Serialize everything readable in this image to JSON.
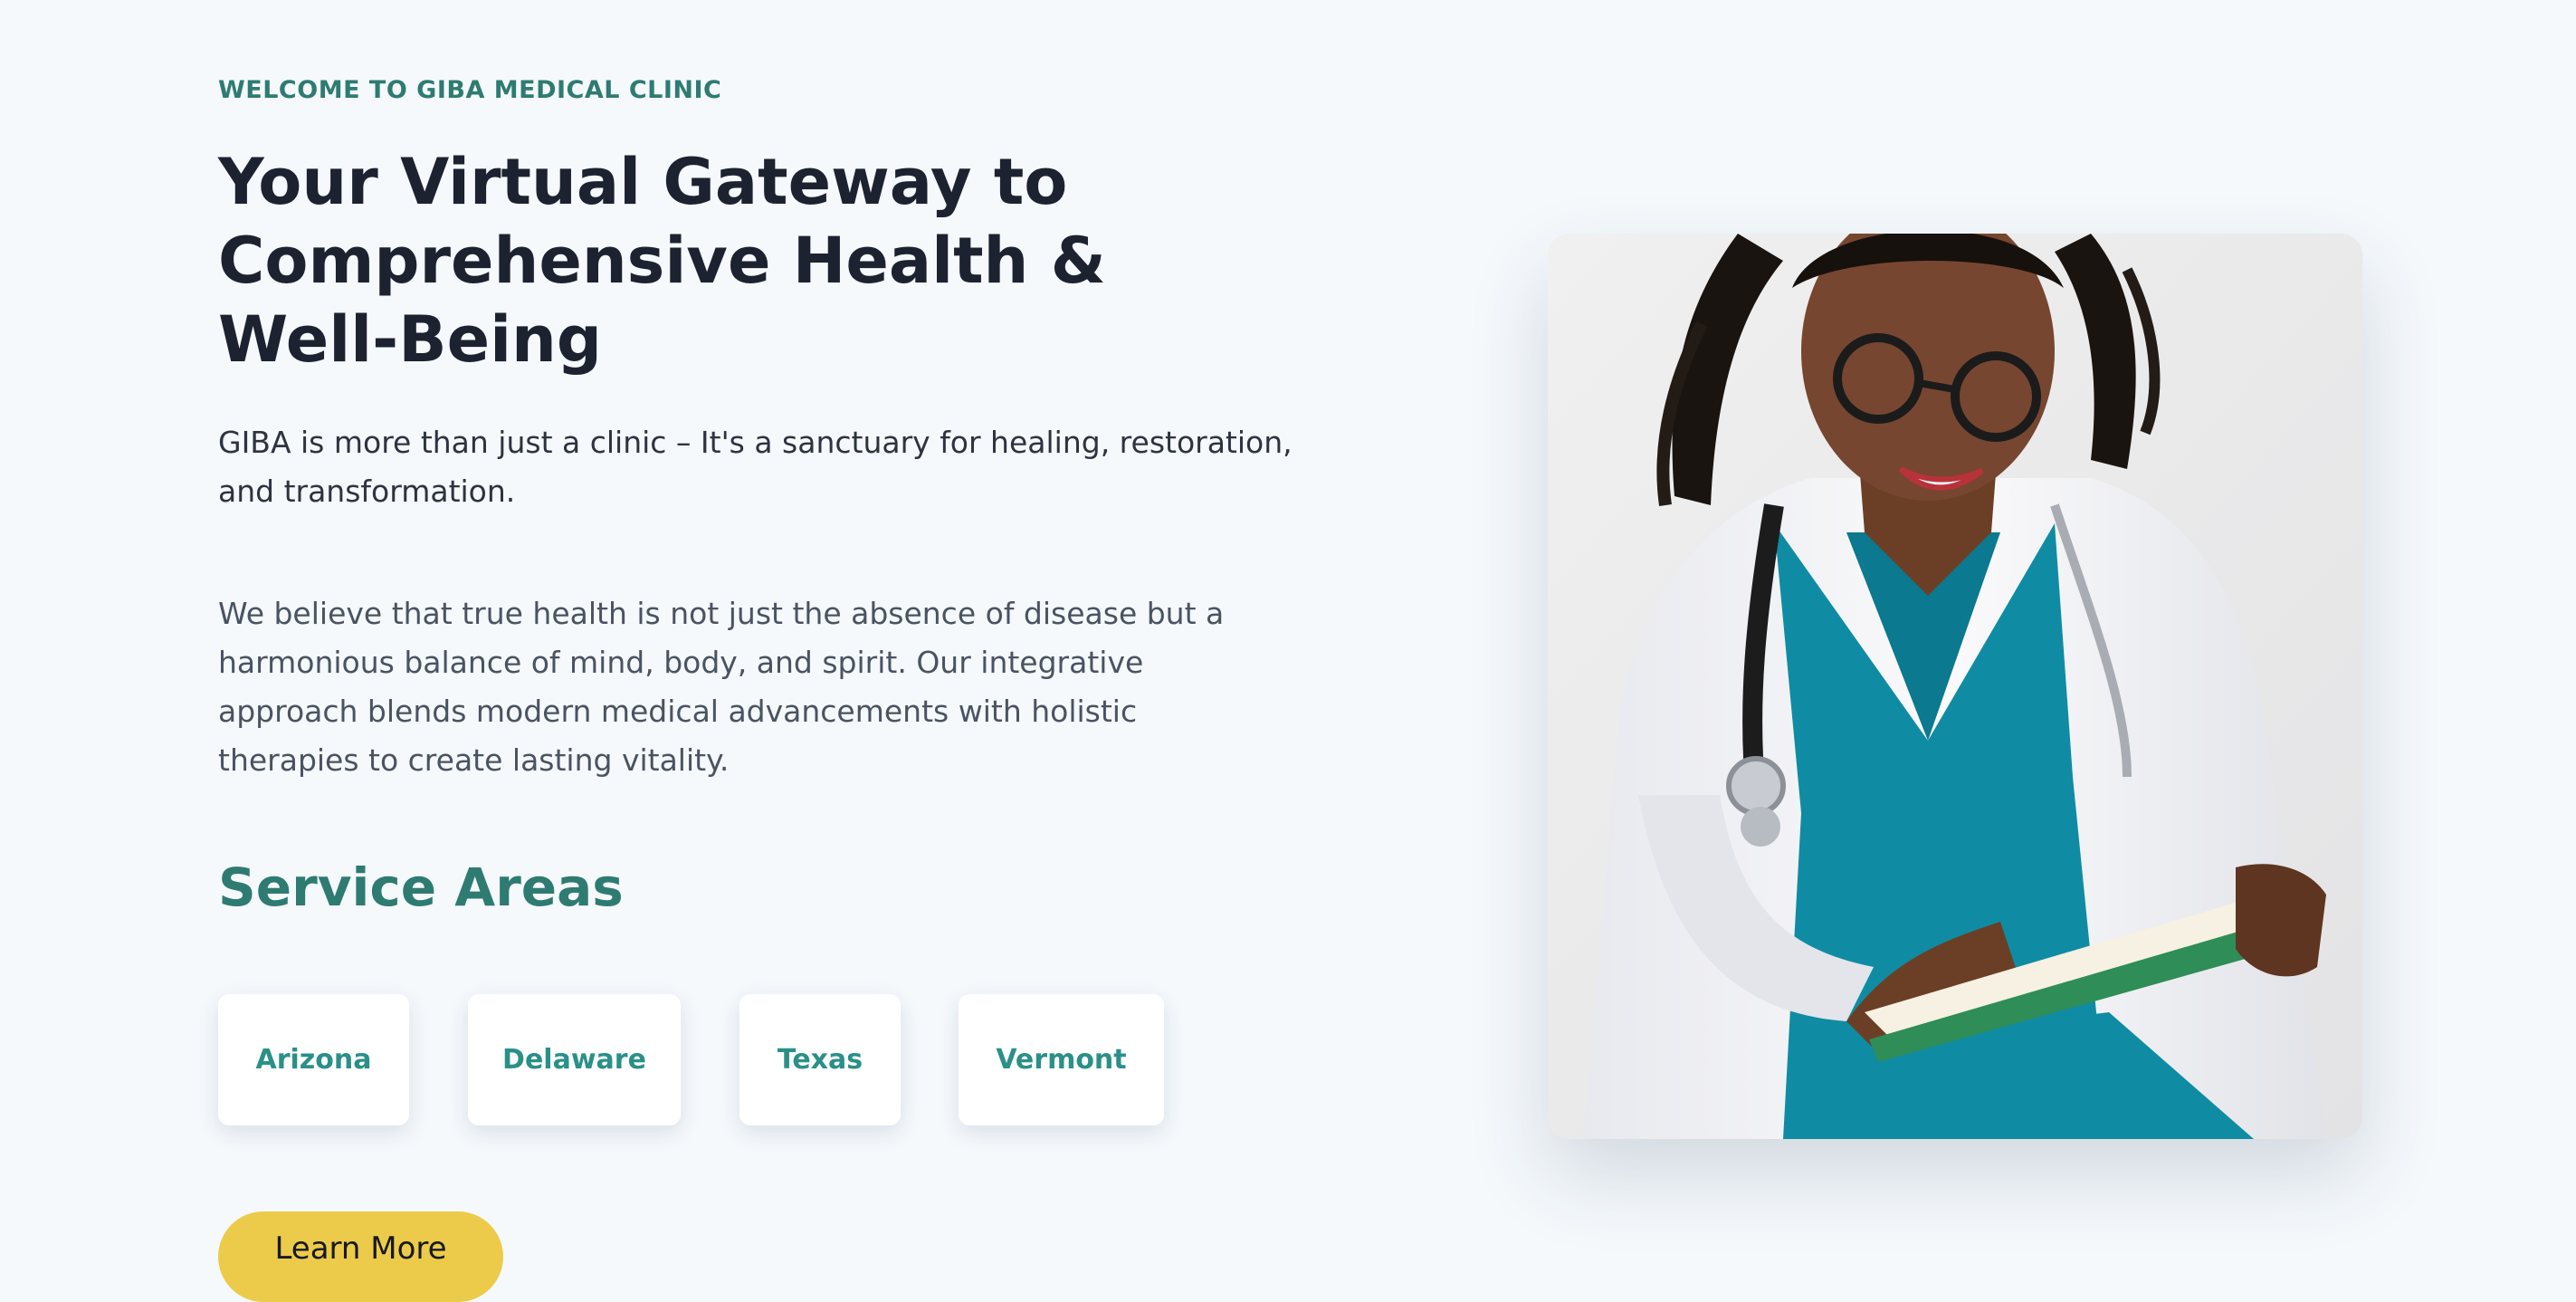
{
  "hero": {
    "eyebrow": "WELCOME TO GIBA MEDICAL CLINIC",
    "headline": "Your Virtual Gateway to Comprehensive Health & Well-Being",
    "lead": "GIBA is more than just a clinic – It's a sanctuary for healing, restoration, and transformation.",
    "body": "We believe that true health is not just the absence of disease but a harmonious balance of mind, body, and spirit. Our integrative approach blends modern medical advancements with holistic therapies to create lasting vitality.",
    "service_title": "Service Areas",
    "service_areas": [
      "Arizona",
      "Delaware",
      "Texas",
      "Vermont"
    ],
    "cta_label": "Learn More"
  },
  "colors": {
    "page_background": "#f5f9fc",
    "accent_teal": "#2e7b72",
    "card_text": "#2a9088",
    "cta_yellow": "#eccb4a",
    "heading_dark": "#1d2231"
  }
}
